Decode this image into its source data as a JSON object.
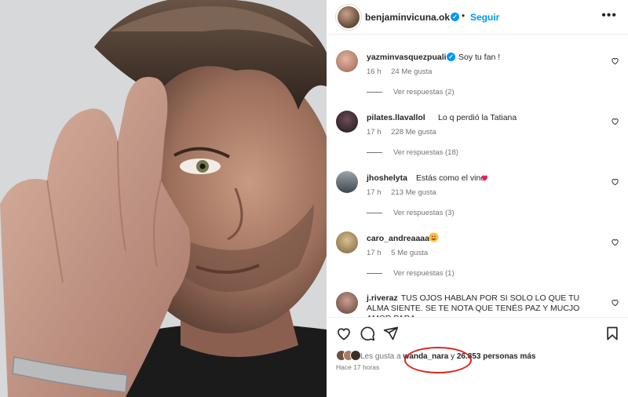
{
  "post": {
    "username": "benjaminvicuna.ok",
    "verified_mark": "✓",
    "separator": "•",
    "follow_label": "Seguir",
    "more_icon": "more-options-icon",
    "more_glyph": "•••"
  },
  "comments": [
    {
      "username": "yazminvasquezpuali",
      "verified": true,
      "text": "Soy tu fan !",
      "time": "16 h",
      "likes": "24 Me gusta",
      "replies": "Ver respuestas (2)",
      "avatar_color": "#c98f7a"
    },
    {
      "username": "pilates.llavallol",
      "verified": false,
      "text": "Lo q perdió la Tatiana",
      "time": "17 h",
      "likes": "228 Me gusta",
      "replies": "Ver respuestas (18)",
      "avatar_color": "#2b2125"
    },
    {
      "username": "jhoshelyta",
      "verified": false,
      "text": "Estás como el vino",
      "emoji": "❤️",
      "time": "17 h",
      "likes": "213 Me gusta",
      "replies": "Ver respuestas (3)",
      "avatar_color": "#5b6770"
    },
    {
      "username": "caro_andreaaaa",
      "verified": false,
      "text": "",
      "emoji": "😍",
      "time": "17 h",
      "likes": "5 Me gusta",
      "replies": "Ver respuestas (1)",
      "avatar_color": "#b59b6a"
    },
    {
      "username": "j.riveraz",
      "verified": false,
      "text": "TUS OJOS HABLAN POR SI SOLO LO QUE TU ALMA SIENTE. SE TE NOTA QUE TENÉS PAZ Y MUCJO AMOR PARA",
      "avatar_color": "#8a6f63"
    }
  ],
  "likes": {
    "prefix": "Les gusta a",
    "user": "wanda_nara",
    "connector": "y",
    "count": "26.853 personas más"
  },
  "time_ago": "Hace 17 horas",
  "colors": {
    "accent": "#0095f6",
    "annotation": "#d9251c",
    "heart_red": "#e0245e"
  },
  "icons": [
    "heart-icon",
    "comment-icon",
    "share-icon",
    "save-icon"
  ]
}
